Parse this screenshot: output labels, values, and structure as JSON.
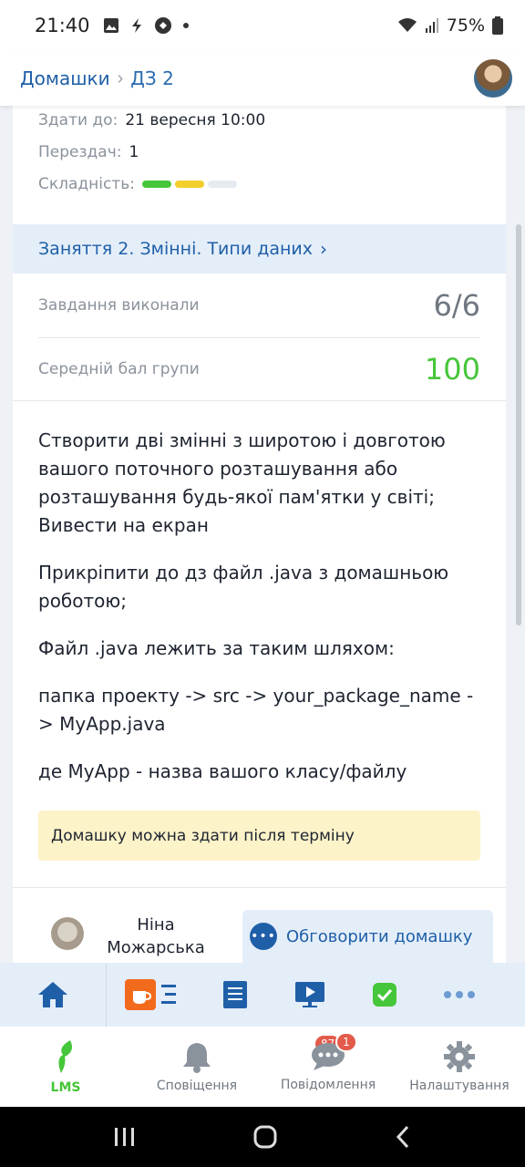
{
  "status": {
    "time": "21:40",
    "battery": "75%"
  },
  "breadcrumb": {
    "parent": "Домашки",
    "current": "ДЗ 2"
  },
  "meta": {
    "due_label": "Здати до:",
    "due_value": "21 вересня 10:00",
    "resubmits_label": "Перездач:",
    "resubmits_value": "1",
    "difficulty_label": "Складність:",
    "difficulty_level": 2,
    "difficulty_max": 3
  },
  "lesson": {
    "title": "Заняття 2. Змінні. Типи даних"
  },
  "stats": {
    "done_label": "Завдання виконали",
    "done_value": "6/6",
    "avg_label": "Середній бал групи",
    "avg_value": "100"
  },
  "description": [
    "Створити дві змінні з широтою і довготою вашого поточного розташування або розташування будь-якої пам'ятки у світі; Вивести на екран",
    "Прикріпити до дз файл .java з домашньою роботою;",
    "Файл .java лежить за таким шляхом:",
    "папка проекту -> src -> your_package_name -> MyApp.java",
    "де MyApp - назва вашого класу/файлу"
  ],
  "notice": "Домашку можна здати після терміну",
  "author": {
    "name": "Ніна Можарська"
  },
  "discuss_button": "Обговорити домашку",
  "tabs": [
    {
      "label": "LMS",
      "active": true
    },
    {
      "label": "Сповіщення",
      "badge": "87"
    },
    {
      "label": "Повідомлення",
      "badge": "1"
    },
    {
      "label": "Налаштування"
    }
  ],
  "colors": {
    "accent": "#1f5fa8",
    "success": "#46c63a",
    "warning_bg": "#fdf3c9"
  }
}
